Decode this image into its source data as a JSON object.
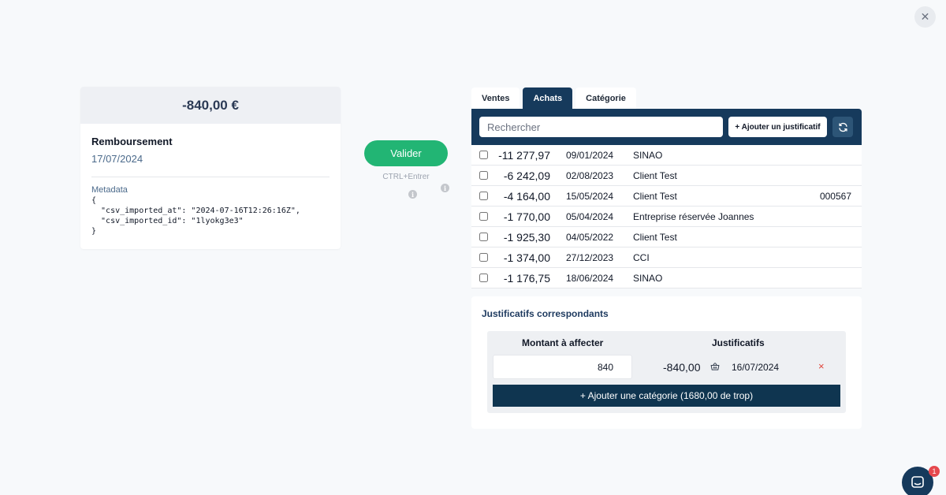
{
  "close": {
    "glyph": "✕"
  },
  "transaction": {
    "amount": "-840,00 €",
    "label": "Remboursement",
    "date": "17/07/2024",
    "metadata_label": "Metadata",
    "metadata_json": "{\n  \"csv_imported_at\": \"2024-07-16T12:26:16Z\",\n  \"csv_imported_id\": \"1lyokg3e3\"\n}"
  },
  "validate": {
    "label": "Valider",
    "shortcut": "CTRL+Entrer"
  },
  "tabs": [
    {
      "label": "Ventes",
      "active": false
    },
    {
      "label": "Achats",
      "active": true
    },
    {
      "label": "Catégorie",
      "active": false
    }
  ],
  "search": {
    "placeholder": "Rechercher",
    "add_button": "+ Ajouter un justificatif"
  },
  "rows": [
    {
      "amount": "-11 277,97",
      "date": "09/01/2024",
      "name": "SINAO",
      "ref": ""
    },
    {
      "amount": "-6 242,09",
      "date": "02/08/2023",
      "name": "Client Test",
      "ref": ""
    },
    {
      "amount": "-4 164,00",
      "date": "15/05/2024",
      "name": "Client Test",
      "ref": "000567"
    },
    {
      "amount": "-1 770,00",
      "date": "05/04/2024",
      "name": "Entreprise réservée Joannes",
      "ref": ""
    },
    {
      "amount": "-1 925,30",
      "date": "04/05/2022",
      "name": "Client Test",
      "ref": ""
    },
    {
      "amount": "-1 374,00",
      "date": "27/12/2023",
      "name": "CCI",
      "ref": ""
    },
    {
      "amount": "-1 176,75",
      "date": "18/06/2024",
      "name": "SINAO",
      "ref": ""
    }
  ],
  "matching": {
    "title": "Justificatifs correspondants",
    "col_amount": "Montant à affecter",
    "col_docs": "Justificatifs",
    "amount_value": "840",
    "doc_amount": "-840,00",
    "doc_date": "16/07/2024",
    "remove_glyph": "×",
    "add_category": "+ Ajouter une catégorie (1680,00 de trop)"
  },
  "chat": {
    "badge": "1"
  },
  "colors": {
    "primary": "#163a5c",
    "success": "#22b574",
    "danger": "#e0453a"
  }
}
